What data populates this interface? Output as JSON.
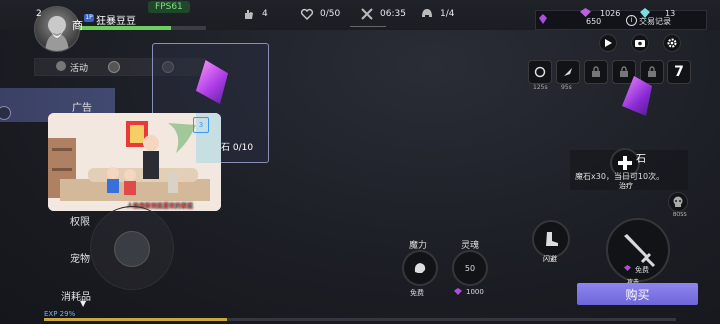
{
  "player": {
    "level": "2",
    "name": "狂暴豆豆",
    "fps": "FPS61",
    "hp_fraction": 0.72
  },
  "top_stats": [
    {
      "icon": "hand-icon",
      "value": "4"
    },
    {
      "icon": "heart-icon",
      "value": "0/50"
    },
    {
      "icon": "crossed-swords-icon",
      "value": "06:35"
    },
    {
      "icon": "helmet-icon",
      "value": "1/4"
    }
  ],
  "currency": {
    "gem": "1026",
    "gem2": "13",
    "sub": "650",
    "record_label": "交易记录"
  },
  "side_menu": {
    "shop_label": "商",
    "activity_label": "活动",
    "ad_label": "广告",
    "items": [
      "权限",
      "宠物",
      "消耗品"
    ]
  },
  "card": {
    "text": "石 0/10"
  },
  "video": {
    "caption": "人极高新到底是欢的家庭",
    "mini_label": "3"
  },
  "controls": {
    "speed_labels": [
      "125s",
      "95s"
    ],
    "number_badge": "7"
  },
  "info": {
    "title": "石",
    "desc": "魔石x30，当日可10次。",
    "heal_label": "治疗",
    "boss_label": "BOSS"
  },
  "skills": {
    "mana_label": "魔力",
    "soul_label": "灵魂",
    "free_label": "免费",
    "soul_value": "50",
    "soul_cost": "1000",
    "dodge_label": "闪避",
    "attack_label": "攻击",
    "attack_free": "免费"
  },
  "buy_label": "购买",
  "exp": {
    "label": "EXP 29%",
    "fraction": 0.29
  },
  "colors": {
    "accent": "#7d74e6",
    "hp": "#6fcf5d",
    "exp": "#c9a93e",
    "gem": "#b04ce0"
  }
}
